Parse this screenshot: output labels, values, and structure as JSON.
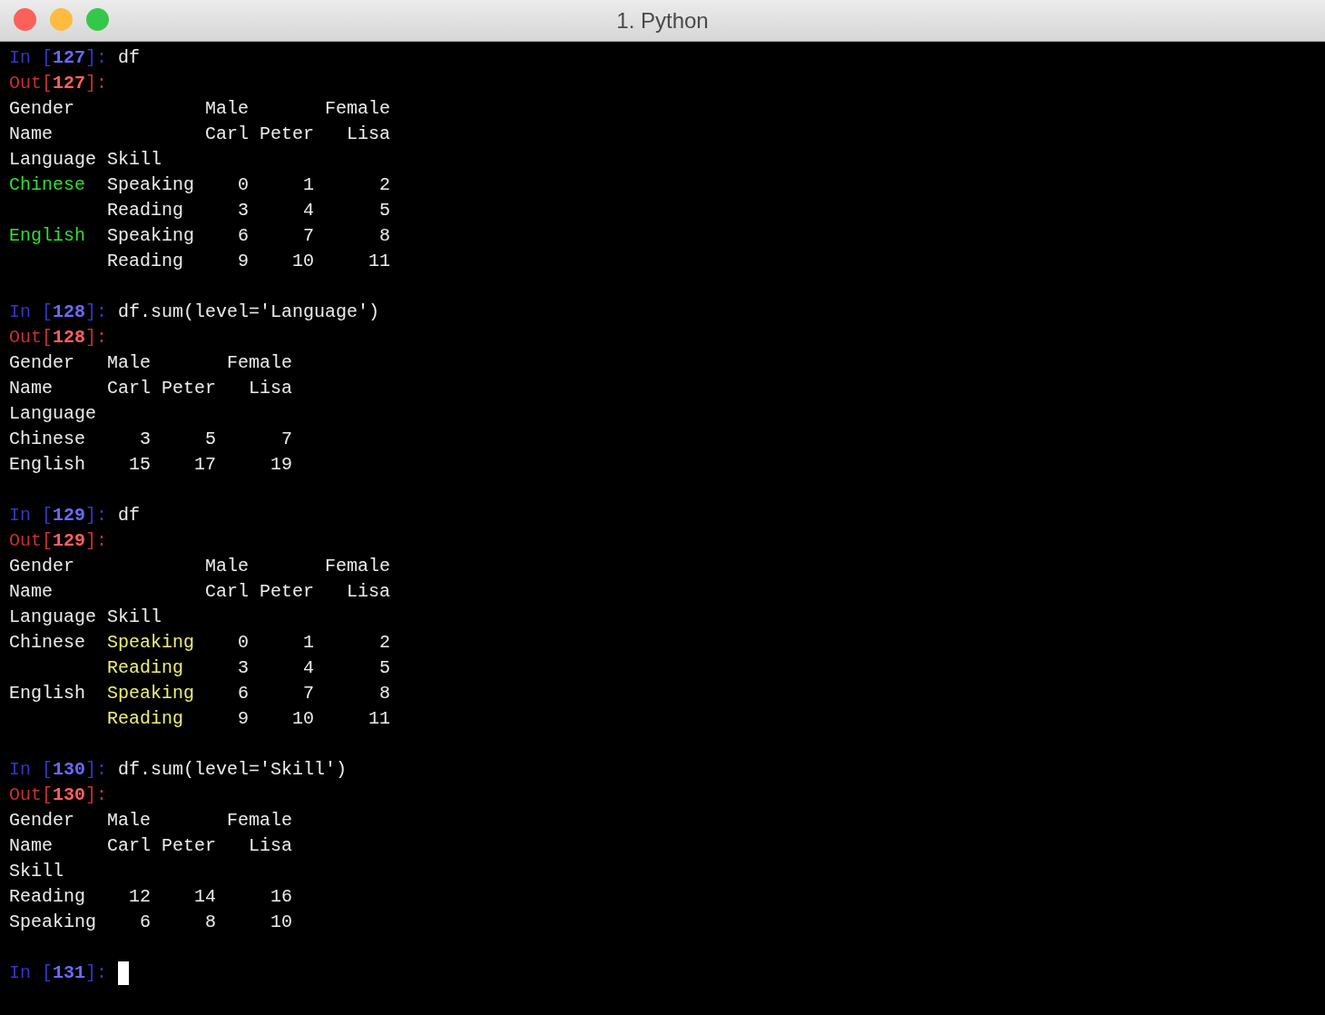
{
  "window": {
    "title": "1. Python"
  },
  "lines": [
    {
      "kind": "input",
      "prefix": "In [",
      "number": "127",
      "suffix": "]:",
      "code": "df"
    },
    {
      "kind": "output",
      "prefix": "Out[",
      "number": "127",
      "suffix": "]:"
    },
    {
      "kind": "text",
      "segments": [
        {
          "text": "Gender            Male       Female"
        }
      ]
    },
    {
      "kind": "text",
      "segments": [
        {
          "text": "Name              Carl Peter   Lisa"
        }
      ]
    },
    {
      "kind": "text",
      "segments": [
        {
          "text": "Language Skill"
        }
      ]
    },
    {
      "kind": "text",
      "segments": [
        {
          "text": "Chinese",
          "color": "#33dd33"
        },
        {
          "text": "  Speaking    0     1      2"
        }
      ]
    },
    {
      "kind": "subrow",
      "segments": [
        {
          "text": "Reading     3     4      5"
        }
      ]
    },
    {
      "kind": "text",
      "segments": [
        {
          "text": "English",
          "color": "#33dd33"
        },
        {
          "text": "  Speaking    6     7      8"
        }
      ]
    },
    {
      "kind": "subrow",
      "segments": [
        {
          "text": "Reading     9    10     11"
        }
      ]
    },
    {
      "kind": "blank"
    },
    {
      "kind": "input",
      "prefix": "In [",
      "number": "128",
      "suffix": "]:",
      "code": "df.sum(level='Language')"
    },
    {
      "kind": "output",
      "prefix": "Out[",
      "number": "128",
      "suffix": "]:"
    },
    {
      "kind": "text",
      "segments": [
        {
          "text": "Gender   Male       Female"
        }
      ]
    },
    {
      "kind": "text",
      "segments": [
        {
          "text": "Name     Carl Peter   Lisa"
        }
      ]
    },
    {
      "kind": "text",
      "segments": [
        {
          "text": "Language"
        }
      ]
    },
    {
      "kind": "text",
      "segments": [
        {
          "text": "Chinese     3     5      7"
        }
      ]
    },
    {
      "kind": "text",
      "segments": [
        {
          "text": "English    15    17     19"
        }
      ]
    },
    {
      "kind": "blank"
    },
    {
      "kind": "input",
      "prefix": "In [",
      "number": "129",
      "suffix": "]:",
      "code": "df"
    },
    {
      "kind": "output",
      "prefix": "Out[",
      "number": "129",
      "suffix": "]:"
    },
    {
      "kind": "text",
      "segments": [
        {
          "text": "Gender            Male       Female"
        }
      ]
    },
    {
      "kind": "text",
      "segments": [
        {
          "text": "Name              Carl Peter   Lisa"
        }
      ]
    },
    {
      "kind": "text",
      "segments": [
        {
          "text": "Language Skill"
        }
      ]
    },
    {
      "kind": "text",
      "segments": [
        {
          "text": "Chinese  "
        },
        {
          "text": "Speaking",
          "color": "#eeee77"
        },
        {
          "text": "    0     1      2"
        }
      ]
    },
    {
      "kind": "subrow",
      "segments": [
        {
          "text": "Reading",
          "color": "#eeee77"
        },
        {
          "text": "     3     4      5"
        }
      ]
    },
    {
      "kind": "text",
      "segments": [
        {
          "text": "English  "
        },
        {
          "text": "Speaking",
          "color": "#eeee77"
        },
        {
          "text": "    6     7      8"
        }
      ]
    },
    {
      "kind": "subrow",
      "segments": [
        {
          "text": "Reading",
          "color": "#eeee77"
        },
        {
          "text": "     9    10     11"
        }
      ]
    },
    {
      "kind": "blank"
    },
    {
      "kind": "input",
      "prefix": "In [",
      "number": "130",
      "suffix": "]:",
      "code": "df.sum(level='Skill')"
    },
    {
      "kind": "output",
      "prefix": "Out[",
      "number": "130",
      "suffix": "]:"
    },
    {
      "kind": "text",
      "segments": [
        {
          "text": "Gender   Male       Female"
        }
      ]
    },
    {
      "kind": "text",
      "segments": [
        {
          "text": "Name     Carl Peter   Lisa"
        }
      ]
    },
    {
      "kind": "text",
      "segments": [
        {
          "text": "Skill"
        }
      ]
    },
    {
      "kind": "text",
      "segments": [
        {
          "text": "Reading    12    14     16"
        }
      ]
    },
    {
      "kind": "text",
      "segments": [
        {
          "text": "Speaking    6     8     10"
        }
      ]
    },
    {
      "kind": "blank"
    },
    {
      "kind": "input",
      "prefix": "In [",
      "number": "131",
      "suffix": "]:",
      "cursor": true
    }
  ]
}
